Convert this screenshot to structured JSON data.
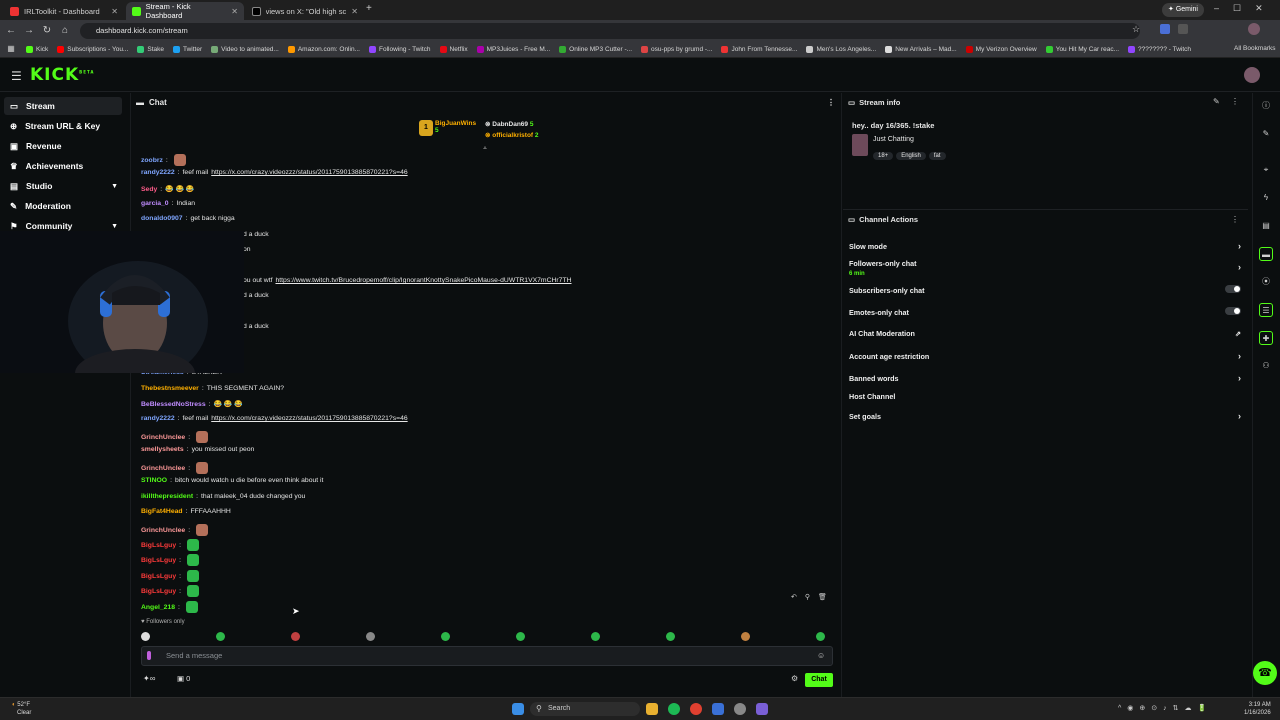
{
  "browser": {
    "tabs": [
      {
        "label": "IRLToolkit - Dashboard"
      },
      {
        "label": "Stream - Kick Dashboard"
      },
      {
        "label": "views on X: \"Old high school vi..."
      }
    ],
    "url": "dashboard.kick.com/stream",
    "gemini_label": "Gemini",
    "bookmarks": [
      "Kick",
      "Subscriptions - You...",
      "Stake",
      "Twitter",
      "Video to animated...",
      "Amazon.com: Onlin...",
      "Following - Twitch",
      "Netflix",
      "MP3Juices - Free M...",
      "Online MP3 Cutter -...",
      "osu-pps by grumd -...",
      "John From Tennesse...",
      "Men's Los Angeles...",
      "New Arrivals – Mad...",
      "My Verizon Overview",
      "You Hit My Car reac...",
      "???????? - Twitch"
    ],
    "all_bookmarks": "All Bookmarks"
  },
  "kick": {
    "logo": "KICK",
    "logo_sup": "BETA"
  },
  "sidebar": {
    "items": [
      {
        "label": "Stream"
      },
      {
        "label": "Stream URL & Key"
      },
      {
        "label": "Revenue"
      },
      {
        "label": "Achievements"
      },
      {
        "label": "Studio"
      },
      {
        "label": "Moderation"
      },
      {
        "label": "Community"
      }
    ]
  },
  "chat": {
    "title": "Chat",
    "leaderboard": [
      {
        "name": "BigJuanWins",
        "count": "5"
      },
      {
        "name": "DabnDan69",
        "count": "5"
      },
      {
        "name": "officialkristof",
        "count": "2"
      }
    ],
    "messages": [
      {
        "user": "zoobrz",
        "text": "",
        "color": "#7fa6ff"
      },
      {
        "user": "randy2222",
        "text": "feef mail ",
        "link": "https://x.com/crazy.videozzz/status/2011759013885870221?s=46",
        "color": "#7fa6ff"
      },
      {
        "user": "Sedy",
        "text": "😂 😂 😂",
        "color": "#ff5c8a"
      },
      {
        "user": "garcia_0",
        "text": "Indian",
        "color": "#c08cff"
      },
      {
        "user": "donaldo0907",
        "text": "get back nigga",
        "color": "#7fa6ff"
      },
      {
        "user": "",
        "text": "d a duck",
        "color": "#e6e6e6"
      },
      {
        "user": "",
        "text": "on",
        "color": "#e6e6e6"
      },
      {
        "user": "",
        "text": "ou out wtf ",
        "link": "https://www.twitch.tv/Brucedropemoff/clip/IgnorantKnottySnakePicoMause-dUWTR1VX7mCHr7TH",
        "color": "#e6e6e6"
      },
      {
        "user": "",
        "text": "d a duck",
        "color": "#e6e6e6"
      },
      {
        "user": "",
        "text": "d a duck",
        "color": "#e6e6e6"
      },
      {
        "user": "Streamerless",
        "text": "STALKER",
        "color": "#7fa6ff"
      },
      {
        "user": "Thebestnsmeever",
        "text": "THIS SEGMENT AGAIN?",
        "color": "#ffb000"
      },
      {
        "user": "BeBlessedNoStress",
        "text": "😂 😂 😂",
        "color": "#c08cff"
      },
      {
        "user": "randy2222",
        "text": "feef mail ",
        "link": "https://x.com/crazy.videozzz/status/2011759013885870221?s=46",
        "color": "#7fa6ff"
      },
      {
        "user": "GrinchUnclee",
        "text": "",
        "color": "#ff9a9a"
      },
      {
        "user": "smellysheets",
        "text": "you missed out peon",
        "color": "#ff9a9a"
      },
      {
        "user": "GrinchUnclee",
        "text": "",
        "color": "#ff9a9a"
      },
      {
        "user": "STINOO",
        "text": "bitch would watch u die before even think about it",
        "color": "#53fc18"
      },
      {
        "user": "ikillthepresident",
        "text": "that maleek_04 dude changed you",
        "color": "#53fc18"
      },
      {
        "user": "BigFat4Head",
        "text": "FFFAAAHHH",
        "color": "#ffb000"
      },
      {
        "user": "GrinchUnclee",
        "text": "",
        "color": "#ff9a9a"
      },
      {
        "user": "BigLsLguy",
        "text": "",
        "color": "#ff3b3b"
      },
      {
        "user": "BigLsLguy",
        "text": "",
        "color": "#ff3b3b"
      },
      {
        "user": "BigLsLguy",
        "text": "",
        "color": "#ff3b3b"
      },
      {
        "user": "BigLsLguy",
        "text": "",
        "color": "#ff3b3b"
      },
      {
        "user": "Angel_218",
        "text": "",
        "color": "#53fc18"
      }
    ],
    "followers_only": "Followers only",
    "input_placeholder": "Send a message",
    "send_label": "Chat",
    "counter": "0"
  },
  "stream_info": {
    "title": "Stream info",
    "stream_title": "hey.. day 16/365. !stake",
    "category": "Just Chatting",
    "tags": [
      "18+",
      "English",
      "fat"
    ]
  },
  "channel_actions": {
    "title": "Channel Actions",
    "items": [
      {
        "label": "Slow mode",
        "sub": ""
      },
      {
        "label": "Followers-only chat",
        "sub": "6 min"
      },
      {
        "label": "Subscribers-only chat",
        "sub": ""
      },
      {
        "label": "Emotes-only chat",
        "sub": ""
      },
      {
        "label": "AI Chat Moderation",
        "sub": ""
      },
      {
        "label": "Account age restriction",
        "sub": ""
      },
      {
        "label": "Banned words",
        "sub": ""
      },
      {
        "label": "Host Channel",
        "sub": ""
      },
      {
        "label": "Set goals",
        "sub": ""
      }
    ]
  },
  "taskbar": {
    "weather_temp": "52°F",
    "weather_desc": "Clear",
    "search": "Search",
    "time": "3:19 AM",
    "date": "1/16/2026"
  },
  "colors": {
    "brand": "#53fc18",
    "bg": "#0b0e0f"
  }
}
